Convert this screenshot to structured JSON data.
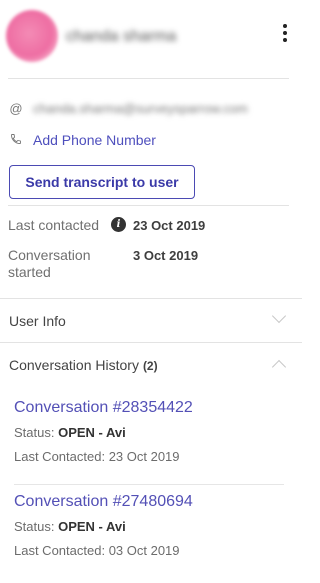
{
  "header": {
    "name_blurred": "chanda sharma",
    "menu_icon": "kebab-menu-icon"
  },
  "contact": {
    "email_blurred": "chanda.sharma@surveysparrow.com",
    "email_icon": "at-icon",
    "phone_icon": "phone-icon",
    "add_phone_label": "Add Phone Number"
  },
  "actions": {
    "send_transcript_label": "Send transcript to user"
  },
  "meta": {
    "last_contacted_label": "Last contacted",
    "last_contacted_value": "23 Oct 2019",
    "started_label_line1": "Conversation",
    "started_label_line2": "started",
    "started_value": "3 Oct 2019"
  },
  "sections": {
    "user_info_label": "User Info",
    "history_label": "Conversation History",
    "history_count": "(2)"
  },
  "conversations": [
    {
      "title": "Conversation #28354422",
      "status_label": "Status:",
      "status_value": "OPEN - Avi",
      "last_label": "Last Contacted:",
      "last_value": "23 Oct 2019"
    },
    {
      "title": "Conversation #27480694",
      "status_label": "Status:",
      "status_value": "OPEN - Avi",
      "last_label": "Last Contacted:",
      "last_value": "03 Oct 2019"
    }
  ],
  "colors": {
    "accent": "#4e4fbd",
    "avatar": "#ee6ea3"
  }
}
